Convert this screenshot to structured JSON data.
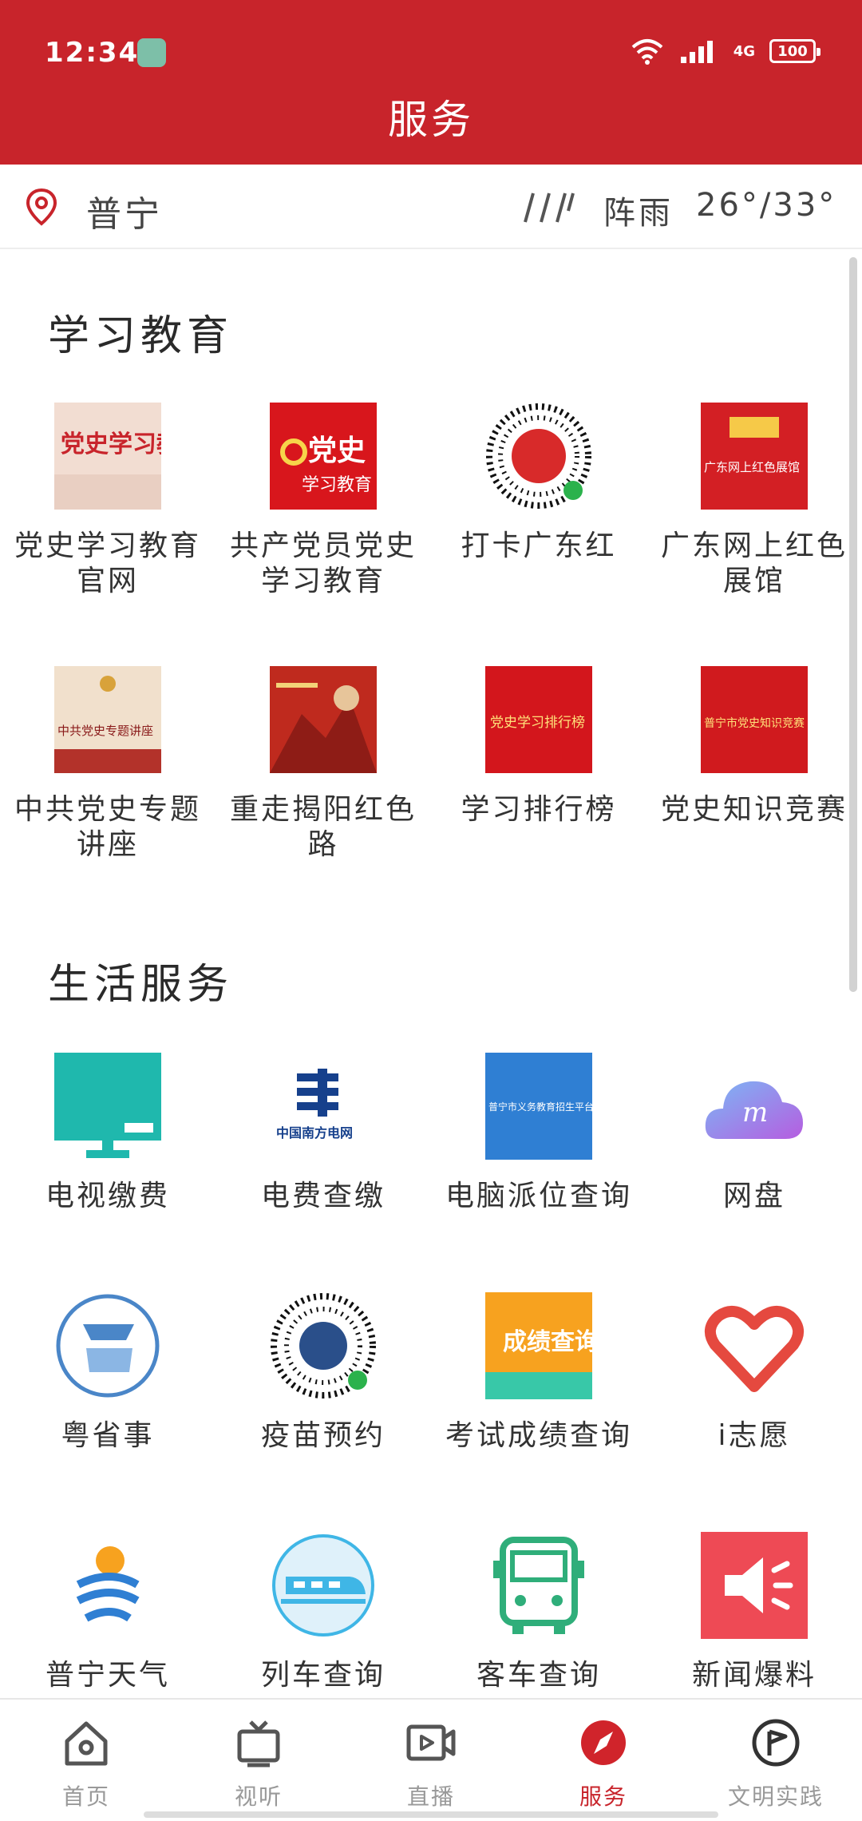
{
  "status": {
    "time": "12:34",
    "network": "4G",
    "battery": "100"
  },
  "header": {
    "title": "服务"
  },
  "location": {
    "city": "普宁",
    "weather": "阵雨",
    "temperature": "26°/33°"
  },
  "sections": [
    {
      "title": "学习教育",
      "items": [
        {
          "label": "党史学习教育官网",
          "icon": "party-history-education-icon",
          "icon_text": "党史学习教育"
        },
        {
          "label": "共产党员党史学习教育",
          "icon": "party-history-banner-icon",
          "icon_text": "党史",
          "icon_sub": "学习教育"
        },
        {
          "label": "打卡广东红",
          "icon": "mini-program-qr-icon"
        },
        {
          "label": "广东网上红色展馆",
          "icon": "red-exhibition-hall-icon",
          "icon_text": "广东网上红色展馆"
        },
        {
          "label": "中共党史专题讲座",
          "icon": "party-lecture-icon",
          "icon_text": "中共党史专题讲座"
        },
        {
          "label": "重走揭阳红色路",
          "icon": "jieyang-red-road-icon"
        },
        {
          "label": "学习排行榜",
          "icon": "study-ranking-icon",
          "icon_text": "党史学习排行榜"
        },
        {
          "label": "党史知识竞赛",
          "icon": "knowledge-contest-icon",
          "icon_text": "普宁市党史知识竞赛"
        }
      ]
    },
    {
      "title": "生活服务",
      "items": [
        {
          "label": "电视缴费",
          "icon": "tv-payment-icon"
        },
        {
          "label": "电费查缴",
          "icon": "china-southern-grid-icon",
          "icon_text": "中国南方电网"
        },
        {
          "label": "电脑派位查询",
          "icon": "school-allocation-icon",
          "icon_text": "普宁市义务教育招生平台"
        },
        {
          "label": "网盘",
          "icon": "cloud-drive-icon"
        },
        {
          "label": "粤省事",
          "icon": "yue-sheng-shi-icon"
        },
        {
          "label": "疫苗预约",
          "icon": "vaccine-qr-icon"
        },
        {
          "label": "考试成绩查询",
          "icon": "exam-score-icon",
          "icon_text": "成绩查询"
        },
        {
          "label": "i志愿",
          "icon": "volunteer-heart-icon"
        },
        {
          "label": "普宁天气",
          "icon": "weather-logo-icon"
        },
        {
          "label": "列车查询",
          "icon": "train-icon"
        },
        {
          "label": "客车查询",
          "icon": "bus-icon"
        },
        {
          "label": "新闻爆料",
          "icon": "news-tip-megaphone-icon"
        }
      ]
    }
  ],
  "nav": [
    {
      "label": "首页",
      "icon": "home-icon",
      "active": false
    },
    {
      "label": "视听",
      "icon": "tv-icon",
      "active": false
    },
    {
      "label": "直播",
      "icon": "live-video-icon",
      "active": false
    },
    {
      "label": "服务",
      "icon": "compass-icon",
      "active": true
    },
    {
      "label": "文明实践",
      "icon": "flag-circle-icon",
      "active": false
    }
  ],
  "colors": {
    "brand": "#c8242b",
    "teal": "#1fb8ad",
    "nav_inactive": "#999999"
  }
}
